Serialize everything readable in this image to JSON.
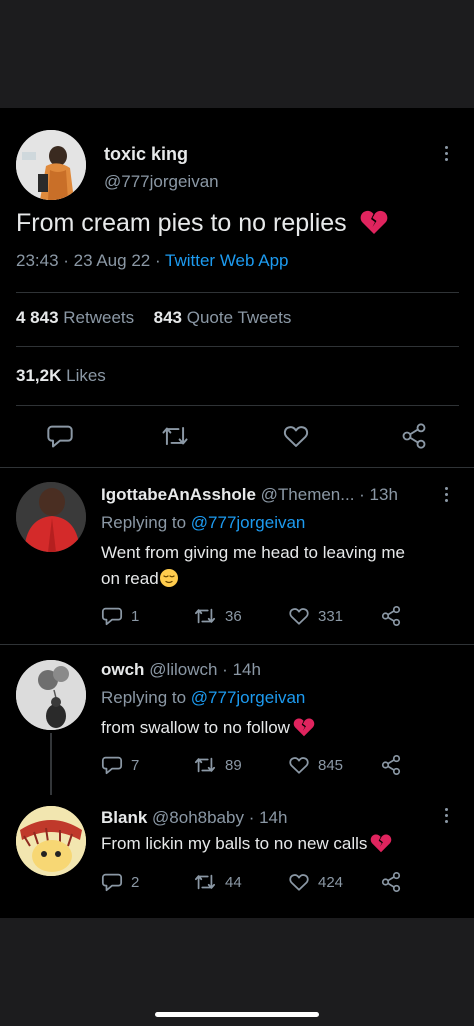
{
  "colors": {
    "background": "#000000",
    "frame": "#1c1c1e",
    "text": "#e7e9ea",
    "muted": "#8b98a5",
    "link": "#1d9bf0",
    "divider": "#2f3336",
    "broken_heart": "#e0245e"
  },
  "tweet": {
    "author_name": "toxic king",
    "author_handle": "@777jorgeivan",
    "text": "From cream pies to no replies",
    "text_emoji": "broken-heart-icon",
    "time": "23:43 · 23 Aug 22 · ",
    "source": "Twitter Web App",
    "retweets_count": "4 843",
    "retweets_label": "Retweets",
    "quotes_count": "843",
    "quotes_label": "Quote Tweets",
    "likes_count": "31,2K",
    "likes_label": "Likes",
    "actions": [
      "reply-icon",
      "retweet-icon",
      "like-icon",
      "share-icon"
    ]
  },
  "replies": [
    {
      "name": "IgottabeAnAsshole",
      "handle_time": "@Themen... · 13h",
      "replying_prefix": "Replying to ",
      "replying_to": "@777jorgeivan",
      "text_line1": "Went from giving me head to leaving me",
      "text_line2": "on read",
      "text_emoji": "relieved-face-icon",
      "reply_count": "1",
      "retweet_count": "36",
      "like_count": "331"
    },
    {
      "name": "owch",
      "handle_time": "@lilowch · 14h",
      "replying_prefix": "Replying to ",
      "replying_to": "@777jorgeivan",
      "text_line1": "from swallow to no follow",
      "text_emoji": "broken-heart-icon",
      "reply_count": "7",
      "retweet_count": "89",
      "like_count": "845"
    },
    {
      "name": "Blank",
      "handle_time": "@8oh8baby · 14h",
      "text_line1": "From lickin my balls to no new calls",
      "text_emoji": "broken-heart-icon",
      "reply_count": "2",
      "retweet_count": "44",
      "like_count": "424"
    }
  ]
}
